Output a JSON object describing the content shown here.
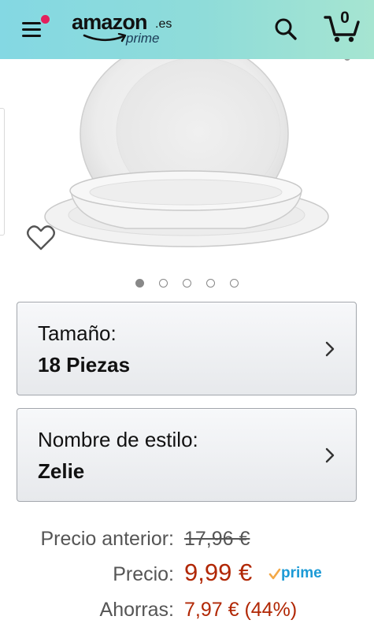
{
  "header": {
    "logo_word": "amazon",
    "logo_tld": ".es",
    "logo_sub": "prime",
    "cart_count": "0",
    "accent_gradient": [
      "#84d8e3",
      "#a6e5d1"
    ],
    "notification_dot_color": "#e3215d"
  },
  "gallery": {
    "image_count": 5,
    "active_index": 0
  },
  "variations": [
    {
      "label": "Tamaño:",
      "value": "18 Piezas"
    },
    {
      "label": "Nombre de estilo:",
      "value": "Zelie"
    }
  ],
  "price": {
    "previous_label": "Precio anterior:",
    "previous_value": "17,96 €",
    "current_label": "Precio:",
    "current_value": "9,99 €",
    "prime_badge": "prime",
    "savings_label": "Ahorras:",
    "savings_value": "7,97 € (44%)",
    "price_color": "#b12704",
    "prime_color": "#1c9ad6"
  },
  "icons": {
    "menu": "menu-icon",
    "search": "search-icon",
    "cart": "cart-icon",
    "wishlist": "heart-icon",
    "chevron": "chevron-right-icon"
  }
}
